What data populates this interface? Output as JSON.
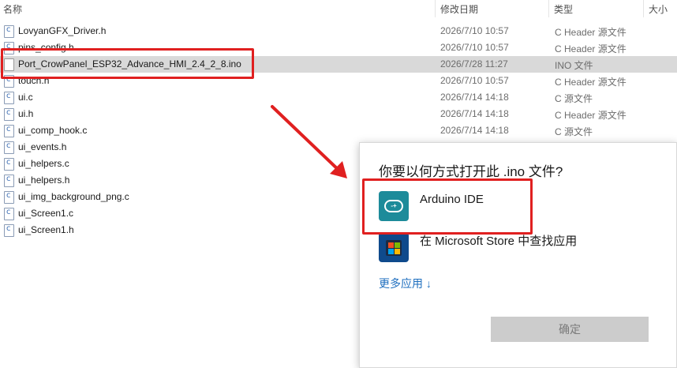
{
  "columns": {
    "name": "名称",
    "date": "修改日期",
    "type": "类型",
    "size": "大小"
  },
  "files": [
    {
      "name": "LovyanGFX_Driver.h",
      "date": "2026/7/10 10:57",
      "type": "C Header 源文件",
      "icon": "c-file-icon"
    },
    {
      "name": "pins_config.h",
      "date": "2026/7/10 10:57",
      "type": "C Header 源文件",
      "icon": "c-file-icon"
    },
    {
      "name": "Port_CrowPanel_ESP32_Advance_HMI_2.4_2_8.ino",
      "date": "2026/7/28 11:27",
      "type": "INO 文件",
      "icon": "ino-file-icon"
    },
    {
      "name": "touch.h",
      "date": "2026/7/10 10:57",
      "type": "C Header 源文件",
      "icon": "c-file-icon"
    },
    {
      "name": "ui.c",
      "date": "2026/7/14 14:18",
      "type": "C 源文件",
      "icon": "c-file-icon"
    },
    {
      "name": "ui.h",
      "date": "2026/7/14 14:18",
      "type": "C Header 源文件",
      "icon": "c-file-icon"
    },
    {
      "name": "ui_comp_hook.c",
      "date": "2026/7/14 14:18",
      "type": "C 源文件",
      "icon": "c-file-icon"
    },
    {
      "name": "ui_events.h",
      "date": "",
      "type": "",
      "icon": "c-file-icon"
    },
    {
      "name": "ui_helpers.c",
      "date": "",
      "type": "",
      "icon": "c-file-icon"
    },
    {
      "name": "ui_helpers.h",
      "date": "",
      "type": "",
      "icon": "c-file-icon"
    },
    {
      "name": "ui_img_background_png.c",
      "date": "",
      "type": "",
      "icon": "c-file-icon"
    },
    {
      "name": "ui_Screen1.c",
      "date": "",
      "type": "",
      "icon": "c-file-icon"
    },
    {
      "name": "ui_Screen1.h",
      "date": "",
      "type": "",
      "icon": "c-file-icon"
    }
  ],
  "dialog": {
    "title": "你要以何方式打开此 .ino 文件?",
    "apps": [
      {
        "label": "Arduino IDE",
        "icon": "arduino-ide-icon"
      },
      {
        "label": "在 Microsoft Store 中查找应用",
        "icon": "microsoft-store-icon"
      }
    ],
    "more_label": "更多应用",
    "more_icon": "arrow-down-icon",
    "ok_label": "确定"
  },
  "edge_text": "13",
  "colors": {
    "highlight": "#e02020",
    "selection": "#d9d9d9",
    "link": "#1f6fbf"
  }
}
